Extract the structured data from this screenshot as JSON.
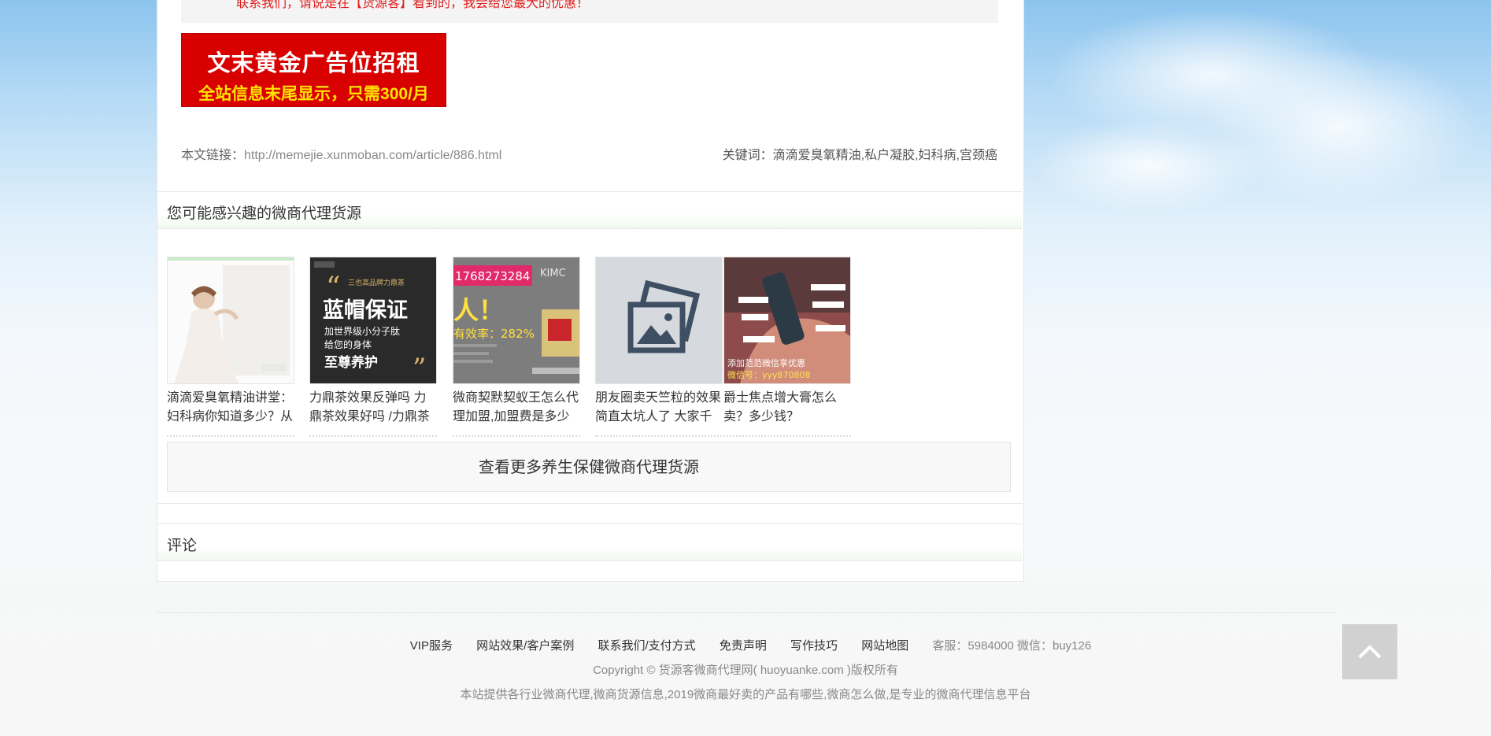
{
  "article": {
    "notice_text": "联系我们，请说是在【货源客】看到的，我会给您最大的优惠！",
    "ad": {
      "line1": "文末黄金广告位招租",
      "line2": "全站信息末尾显示，只需300/月"
    },
    "link_label": "本文链接：",
    "link_url": "http://memejie.xunmoban.com/article/886.html",
    "keywords_label": "关键词：",
    "keywords": "滴滴爱臭氧精油,私户凝胶,妇科病,宫颈癌"
  },
  "related": {
    "heading": "您可能感兴趣的微商代理货源",
    "items": [
      {
        "title": "滴滴爱臭氧精油讲堂：妇科病你知道多少？从"
      },
      {
        "title": "力鼎茶效果反弹吗 力鼎茶效果好吗 /力鼎茶",
        "img": {
          "small": "三也高品牌力鼎茶",
          "big": "蓝帽保证",
          "sub1": "加世界级小分子肽",
          "sub2": "给您的身体",
          "sub3": "至尊养护"
        }
      },
      {
        "title": "微商契默契蚁王怎么代理加盟,加盟费是多少",
        "img": {
          "phone": "1768273284",
          "brand": "KIMC",
          "big": "人！",
          "rate": "有效率：282%"
        }
      },
      {
        "title": "朋友圈卖天竺粒的效果简直太坑人了 大家千"
      },
      {
        "title": "爵士焦点增大膏怎么卖？多少钱？",
        "img": {
          "promo": "添加范范微信享优惠",
          "wechat": "微信号：yyy870808"
        }
      }
    ],
    "more_label": "查看更多养生保健微商代理货源"
  },
  "comments": {
    "heading": "评论"
  },
  "footer": {
    "links": [
      "VIP服务",
      "网站效果/客户案例",
      "联系我们/支付方式",
      "免责声明",
      "写作技巧",
      "网站地图"
    ],
    "service": "客服：5984000 微信：buy126",
    "copyright": "Copyright © 货源客微商代理网( huoyuanke.com )版权所有",
    "description": "本站提供各行业微商代理,微商货源信息,2019微商最好卖的产品有哪些,微商怎么做,是专业的微商代理信息平台"
  },
  "colors": {
    "ad_bg": "#d90000",
    "ad_sub": "#ffe400",
    "notice_text": "#e02020",
    "backtop_bg": "#d1d1d1"
  }
}
